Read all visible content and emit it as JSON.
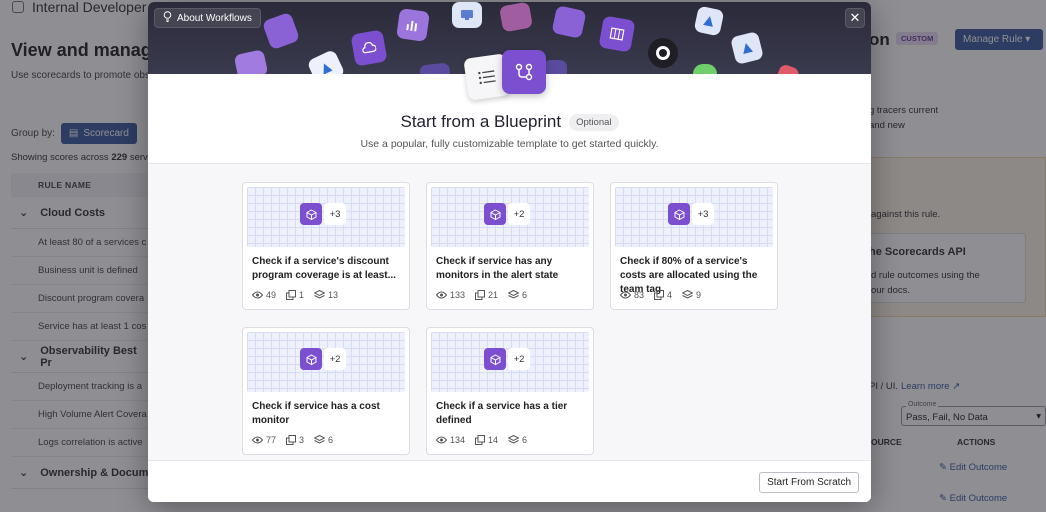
{
  "background": {
    "app_title": "Internal Developer",
    "page_title": "View and manage",
    "page_subtitle": "Use scorecards to promote obs",
    "group_by_label": "Group by:",
    "group_by_value": "Scorecard",
    "showing_prefix": "Showing scores across",
    "showing_count": "229",
    "showing_suffix": "serv",
    "column_header": "RULE NAME",
    "groups": [
      {
        "name": "Cloud Costs",
        "rows": [
          "At least 80 of a services c",
          "Business unit is defined",
          "Discount program covera",
          "Service has at least 1 cos"
        ]
      },
      {
        "name": "Observability Best Pr",
        "rows": [
          "Deployment tracking is a",
          "High Volume Alert Covera",
          "Logs correlation is active"
        ]
      },
      {
        "name": "Ownership & Docum",
        "rows": []
      }
    ],
    "right": {
      "title": "on",
      "custom_badge": "CUSTOM",
      "manage_button": "Manage Rule",
      "text1": "g tracers current",
      "text2": "and new",
      "text3": "against this rule.",
      "api_title": "he Scorecards API",
      "api_text1": "d rule outcomes using the",
      "api_text2": "our docs.",
      "api_link_text": "PI / UI.",
      "learn_more": "Learn more",
      "outcome_label": "Outcome",
      "outcome_value": "Pass, Fail, No Data",
      "source_header": "OURCE",
      "actions_header": "ACTIONS",
      "edit_outcome": "Edit Outcome"
    }
  },
  "modal": {
    "about_button": "About Workflows",
    "heading": "Start from a Blueprint",
    "optional_badge": "Optional",
    "subtext": "Use a popular, fully customizable template to get started quickly.",
    "footer_button": "Start From Scratch",
    "cards": [
      {
        "plus": "+3",
        "title": "Check if a service's discount program coverage is at least...",
        "views": "49",
        "copies": "1",
        "layers": "13"
      },
      {
        "plus": "+2",
        "title": "Check if service has any monitors in the alert state",
        "views": "133",
        "copies": "21",
        "layers": "6"
      },
      {
        "plus": "+3",
        "title": "Check if 80% of a service's costs are allocated using the team tag",
        "views": "83",
        "copies": "4",
        "layers": "9"
      },
      {
        "plus": "+2",
        "title": "Check if service has a cost monitor",
        "views": "77",
        "copies": "3",
        "layers": "6"
      },
      {
        "plus": "+2",
        "title": "Check if a service has a tier defined",
        "views": "134",
        "copies": "14",
        "layers": "6"
      }
    ]
  },
  "colors": {
    "accent_purple": "#7b4fd0",
    "brand_blue": "#3d5a9e",
    "hero_dark": "#2a2a3a"
  }
}
